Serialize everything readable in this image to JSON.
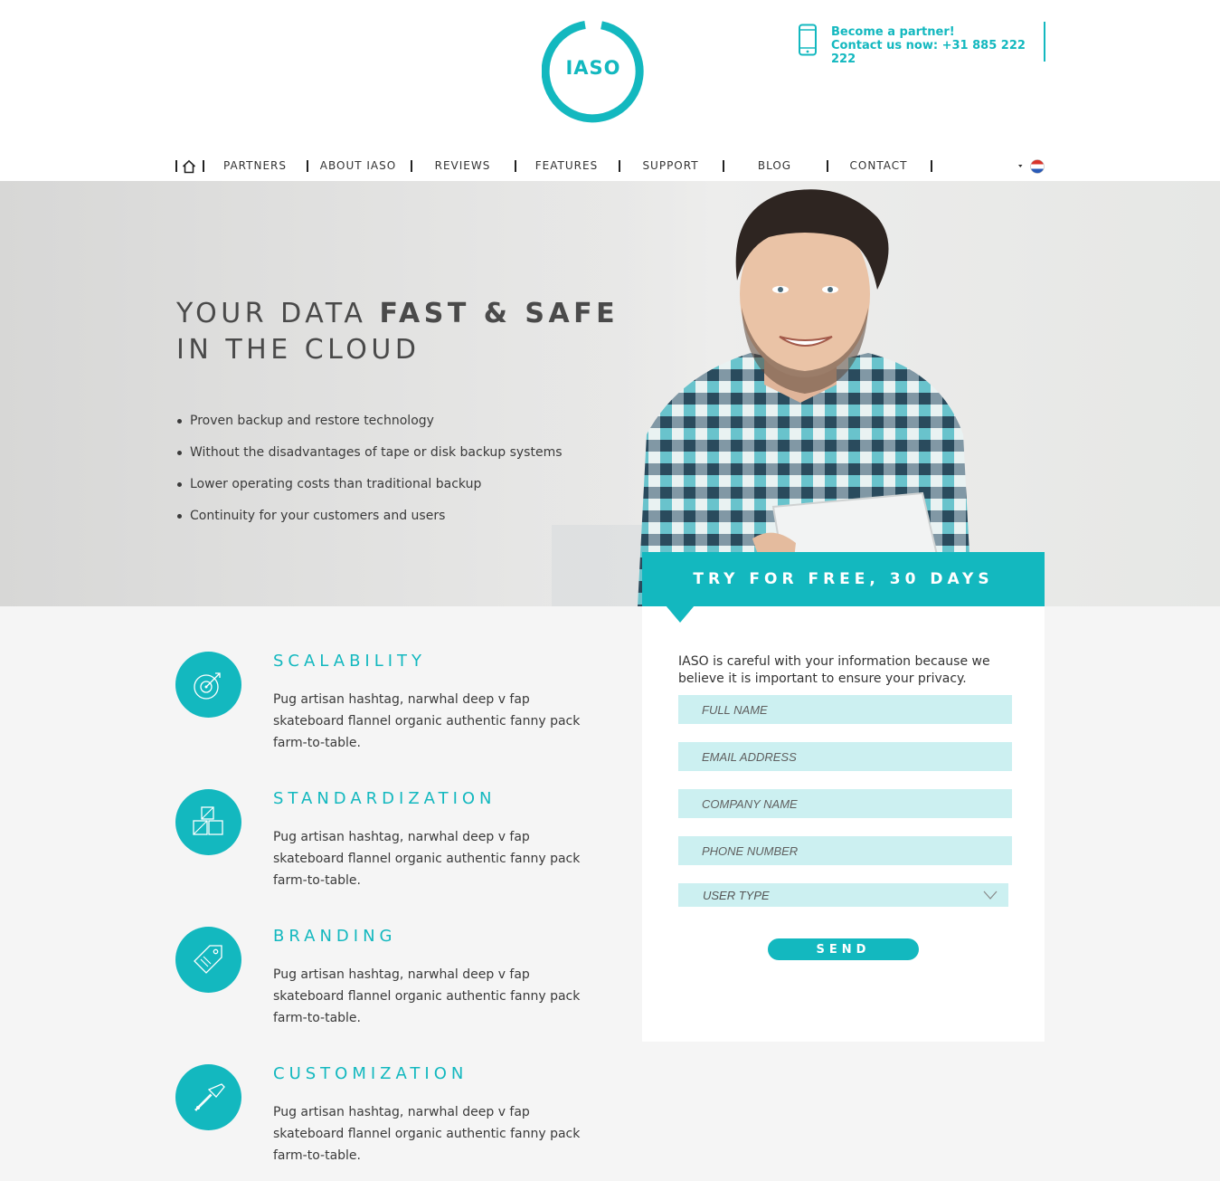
{
  "brand": {
    "logo_text": "IASO",
    "accent_color": "#13b8bf"
  },
  "contact": {
    "line1": "Become a partner!",
    "line2": "Contact us now: +31 885 222 222",
    "icon": "phone-icon"
  },
  "nav": {
    "home_icon": "home-icon",
    "items": [
      {
        "label": "PARTNERS"
      },
      {
        "label": "ABOUT IASO"
      },
      {
        "label": "REVIEWS"
      },
      {
        "label": "FEATURES"
      },
      {
        "label": "SUPPORT"
      },
      {
        "label": "BLOG"
      },
      {
        "label": "CONTACT"
      }
    ],
    "language_icon": "netherlands-flag-icon"
  },
  "hero": {
    "title_part1": "YOUR DATA ",
    "title_bold": "FAST & SAFE",
    "title_line2": "IN THE CLOUD",
    "bullets": [
      "Proven backup and restore technology",
      "Without the disadvantages of tape or disk backup systems",
      "Lower operating costs than traditional backup",
      "Continuity for your customers and users"
    ]
  },
  "features": [
    {
      "title": "SCALABILITY",
      "text": "Pug artisan hashtag, narwhal deep v fap skateboard flannel organic authentic fanny pack farm-to-table.",
      "icon": "target-icon"
    },
    {
      "title": "STANDARDIZATION",
      "text": "Pug artisan hashtag, narwhal deep v fap skateboard flannel organic authentic fanny pack farm-to-table.",
      "icon": "blocks-icon"
    },
    {
      "title": "BRANDING",
      "text": "Pug artisan hashtag, narwhal deep v fap skateboard flannel organic authentic fanny pack farm-to-table.",
      "icon": "tag-icon"
    },
    {
      "title": "CUSTOMIZATION",
      "text": "Pug artisan hashtag, narwhal deep v fap skateboard flannel organic authentic fanny pack farm-to-table.",
      "icon": "screwdriver-icon"
    }
  ],
  "form": {
    "banner": "TRY FOR FREE, 30 DAYS",
    "intro": "IASO is careful with your information because we believe it is important to ensure your privacy.",
    "fields": [
      {
        "placeholder": "FULL NAME",
        "value": ""
      },
      {
        "placeholder": "EMAIL ADDRESS",
        "value": ""
      },
      {
        "placeholder": "COMPANY NAME",
        "value": ""
      },
      {
        "placeholder": "PHONE NUMBER",
        "value": ""
      }
    ],
    "user_type": "USER TYPE",
    "send_label": "SEND"
  }
}
